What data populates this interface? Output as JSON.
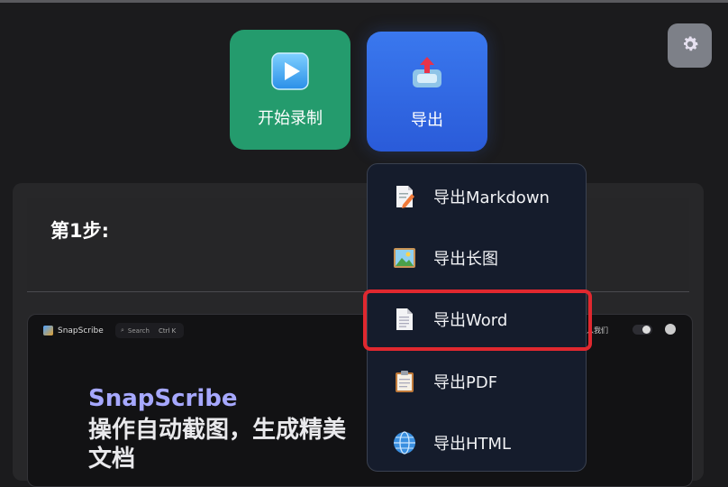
{
  "toolbar": {
    "record_label": "开始录制",
    "export_label": "导出"
  },
  "settings": {
    "icon": "gear-icon"
  },
  "step": {
    "title": "第1步:"
  },
  "preview": {
    "brand": "SnapScribe",
    "search_placeholder": "Search",
    "search_shortcut": "Ctrl K",
    "about_link": "入我们",
    "heading": "SnapScribe",
    "subheading": "操作自动截图，生成精美文档"
  },
  "export_menu": {
    "items": [
      {
        "label": "导出Markdown",
        "icon": "markdown-pencil-icon"
      },
      {
        "label": "导出长图",
        "icon": "picture-icon"
      },
      {
        "label": "导出Word",
        "icon": "word-document-icon"
      },
      {
        "label": "导出PDF",
        "icon": "pdf-clipboard-icon"
      },
      {
        "label": "导出HTML",
        "icon": "globe-icon"
      }
    ],
    "highlighted_index": 2,
    "highlight_color": "#e0282f"
  },
  "colors": {
    "record_button": "#249b6d",
    "export_button": "#3a78ee",
    "menu_bg": "#151c2c"
  }
}
